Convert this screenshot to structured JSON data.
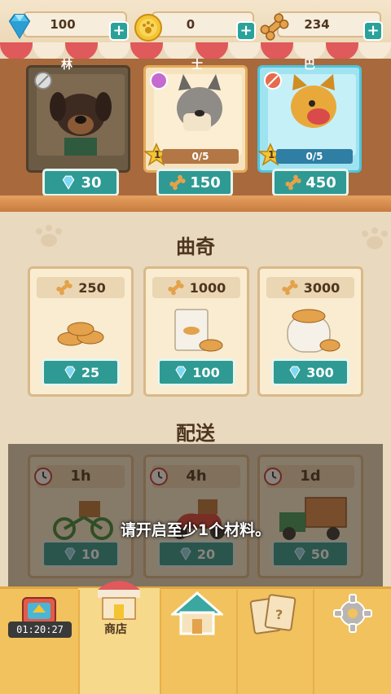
{
  "currencies": {
    "gems": "100",
    "coins": "0",
    "bones": "234",
    "plus_label": "+"
  },
  "dog_cards": [
    {
      "name_partial": "林",
      "price": "30",
      "price_currency": "gem"
    },
    {
      "name_partial": "士",
      "level": "1",
      "progress": "0/5",
      "price": "150",
      "price_currency": "bone"
    },
    {
      "name_partial": "巴",
      "level": "1",
      "progress": "0/5",
      "price": "450",
      "price_currency": "bone"
    }
  ],
  "cookies_section": {
    "title": "曲奇",
    "items": [
      {
        "amount": "250",
        "price": "25"
      },
      {
        "amount": "1000",
        "price": "100"
      },
      {
        "amount": "3000",
        "price": "300"
      }
    ]
  },
  "delivery_section": {
    "title": "配送",
    "items": [
      {
        "time": "1h",
        "price": "10"
      },
      {
        "time": "4h",
        "price": "20"
      },
      {
        "time": "1d",
        "price": "50"
      }
    ]
  },
  "toast": "请开启至少1个材料。",
  "bottom_nav": {
    "timer": "01:20:27",
    "shop_label": "商店"
  },
  "colors": {
    "accent_teal": "#2e9a93",
    "nav_yellow": "#f1c25d",
    "wood": "#a8693c"
  }
}
